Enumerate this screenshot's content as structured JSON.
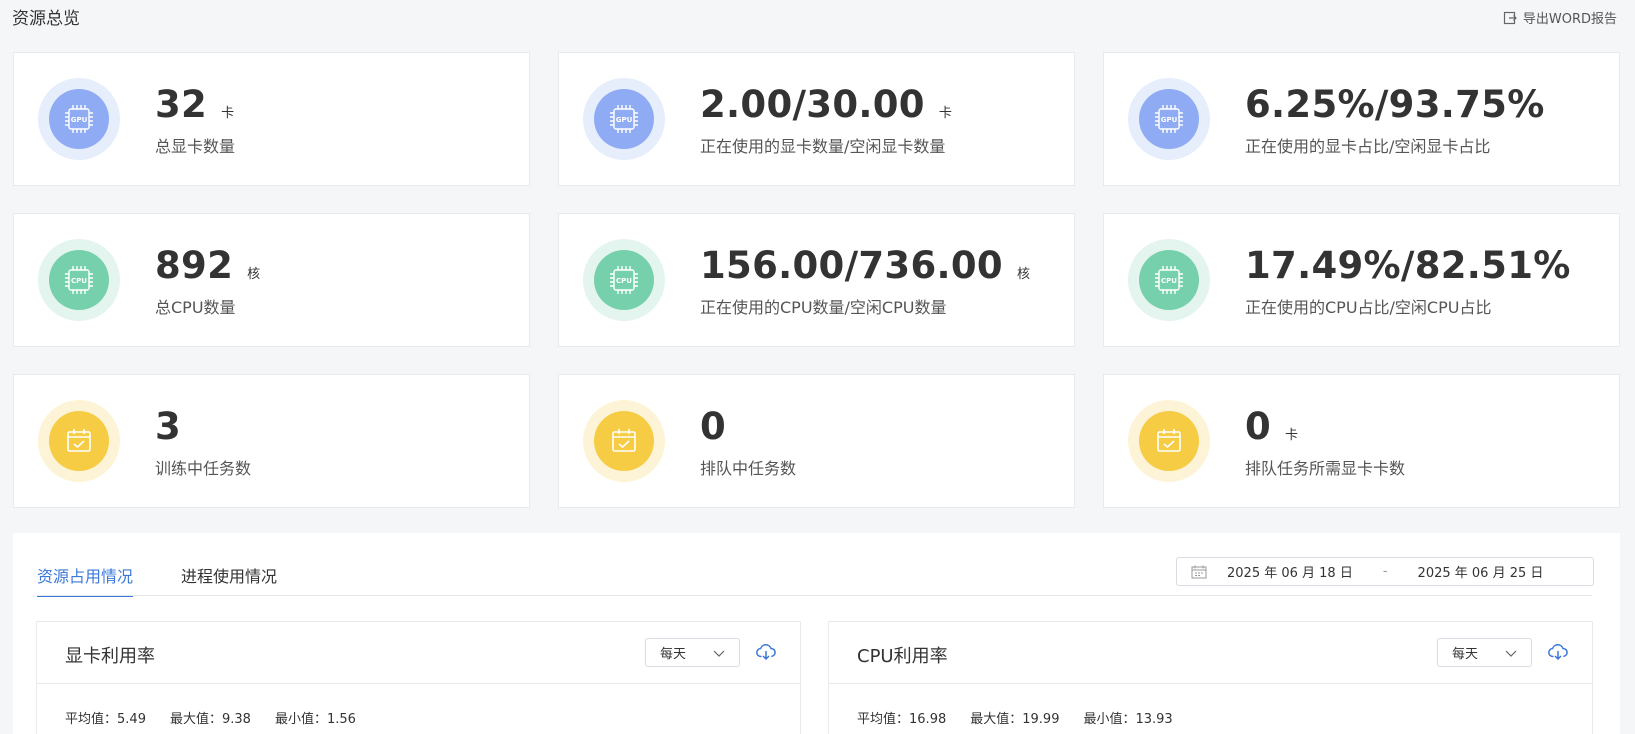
{
  "page_title": "资源总览",
  "export_label": "导出WORD报告",
  "cards": [
    {
      "value": "32",
      "unit": "卡",
      "label": "总显卡数量",
      "icon": "gpu-icon",
      "icon_text": "GPU"
    },
    {
      "value": "2.00/30.00",
      "unit": "卡",
      "label": "正在使用的显卡数量/空闲显卡数量",
      "icon": "gpu-icon",
      "icon_text": "GPU"
    },
    {
      "value": "6.25%/93.75%",
      "unit": "",
      "label": "正在使用的显卡占比/空闲显卡占比",
      "icon": "gpu-icon",
      "icon_text": "GPU"
    },
    {
      "value": "892",
      "unit": "核",
      "label": "总CPU数量",
      "icon": "cpu-icon",
      "icon_text": "CPU"
    },
    {
      "value": "156.00/736.00",
      "unit": "核",
      "label": "正在使用的CPU数量/空闲CPU数量",
      "icon": "cpu-icon",
      "icon_text": "CPU"
    },
    {
      "value": "17.49%/82.51%",
      "unit": "",
      "label": "正在使用的CPU占比/空闲CPU占比",
      "icon": "cpu-icon",
      "icon_text": "CPU"
    },
    {
      "value": "3",
      "unit": "",
      "label": "训练中任务数",
      "icon": "calendar-check-icon"
    },
    {
      "value": "0",
      "unit": "",
      "label": "排队中任务数",
      "icon": "calendar-check-icon"
    },
    {
      "value": "0",
      "unit": "卡",
      "label": "排队任务所需显卡卡数",
      "icon": "calendar-check-icon"
    }
  ],
  "tabs": [
    {
      "label": "资源占用情况",
      "active": true
    },
    {
      "label": "进程使用情况",
      "active": false
    }
  ],
  "date_range": {
    "start": "2025 年 06 月 18 日",
    "separator": "-",
    "end": "2025 年 06 月 25 日"
  },
  "charts": [
    {
      "title": "显卡利用率",
      "period": "每天",
      "stats": {
        "avg_label": "平均值：",
        "avg": "5.49",
        "max_label": "最大值：",
        "max": "9.38",
        "min_label": "最小值：",
        "min": "1.56"
      }
    },
    {
      "title": "CPU利用率",
      "period": "每天",
      "stats": {
        "avg_label": "平均值：",
        "avg": "16.98",
        "max_label": "最大值：",
        "max": "19.99",
        "min_label": "最小值：",
        "min": "13.93"
      }
    }
  ],
  "colors": {
    "gpu": "#8eabf3",
    "cpu": "#77d0ac",
    "task": "#f6cc45",
    "accent": "#3c78d8"
  }
}
